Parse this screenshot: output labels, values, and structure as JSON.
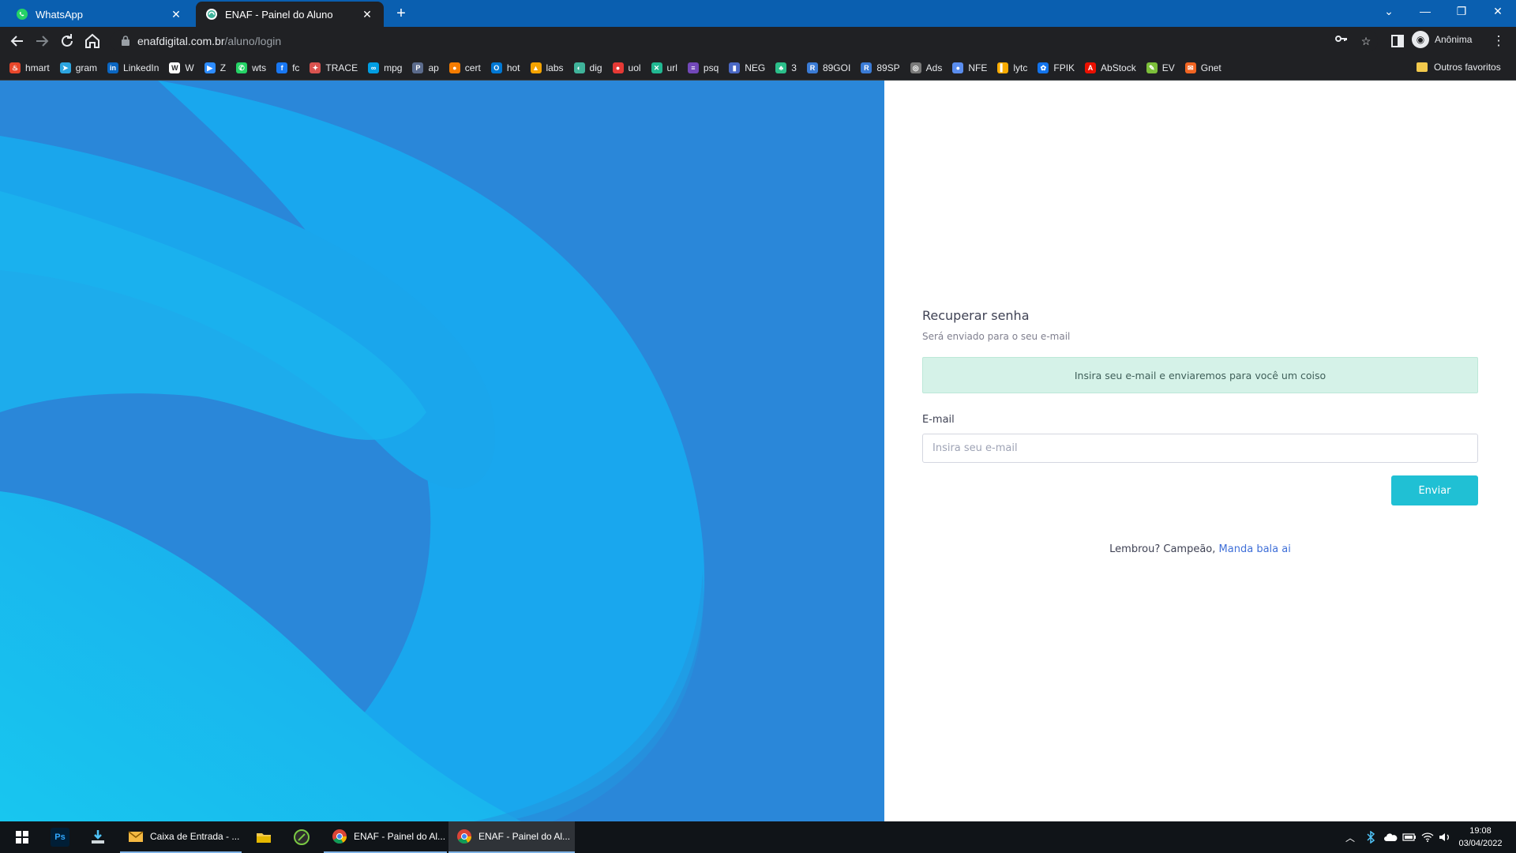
{
  "browser": {
    "tabs": [
      {
        "title": "WhatsApp",
        "icon": "whatsapp-icon",
        "active": false
      },
      {
        "title": "ENAF - Painel do Aluno",
        "icon": "enaf-icon",
        "active": true
      }
    ],
    "url_host": "enafdigital.com.br",
    "url_path": "/aluno/login",
    "profile_label": "Anônima",
    "bookmarks": [
      {
        "label": "hmart",
        "icon": "flame-icon",
        "color": "#e8472b"
      },
      {
        "label": "gram",
        "icon": "telegram-icon",
        "color": "#2ca5e0"
      },
      {
        "label": "LinkedIn",
        "icon": "linkedin-icon",
        "color": "#0a66c2"
      },
      {
        "label": "W",
        "icon": "wix-icon",
        "color": "#ffffff"
      },
      {
        "label": "Z",
        "icon": "zoom-icon",
        "color": "#2d8cff"
      },
      {
        "label": "wts",
        "icon": "whatsapp-icon",
        "color": "#25d366"
      },
      {
        "label": "fc",
        "icon": "facebook-icon",
        "color": "#1877f2"
      },
      {
        "label": "TRACE",
        "icon": "trace-icon",
        "color": "#d9534f"
      },
      {
        "label": "mpg",
        "icon": "mercadopago-icon",
        "color": "#009ee3"
      },
      {
        "label": "ap",
        "icon": "paypal-icon",
        "color": "#5b6b8c"
      },
      {
        "label": "cert",
        "icon": "cert-icon",
        "color": "#f57c00"
      },
      {
        "label": "hot",
        "icon": "outlook-icon",
        "color": "#0078d4"
      },
      {
        "label": "labs",
        "icon": "labs-icon",
        "color": "#f4a300"
      },
      {
        "label": "dig",
        "icon": "enaf-icon",
        "color": "#3fb39a"
      },
      {
        "label": "uol",
        "icon": "uol-icon",
        "color": "#e53935"
      },
      {
        "label": "url",
        "icon": "url-icon",
        "color": "#21b892"
      },
      {
        "label": "psq",
        "icon": "forms-icon",
        "color": "#7248b9"
      },
      {
        "label": "NEG",
        "icon": "neg-icon",
        "color": "#4a68c4"
      },
      {
        "label": "3",
        "icon": "tree-icon",
        "color": "#2bbf8a"
      },
      {
        "label": "89GOI",
        "icon": "r-icon",
        "color": "#3a7bd5"
      },
      {
        "label": "89SP",
        "icon": "r-icon",
        "color": "#3a7bd5"
      },
      {
        "label": "Ads",
        "icon": "ads-icon",
        "color": "#7a7a7a"
      },
      {
        "label": "NFE",
        "icon": "nfe-icon",
        "color": "#5a8dee"
      },
      {
        "label": "lytc",
        "icon": "analytics-icon",
        "color": "#f9ab00"
      },
      {
        "label": "FPIK",
        "icon": "freepik-icon",
        "color": "#1273eb"
      },
      {
        "label": "AbStock",
        "icon": "adobe-icon",
        "color": "#eb1000"
      },
      {
        "label": "EV",
        "icon": "evernote-icon",
        "color": "#7cbf3a"
      },
      {
        "label": "Gnet",
        "icon": "gnet-icon",
        "color": "#f26522"
      }
    ],
    "other_bookmarks": "Outros favoritos"
  },
  "page": {
    "title": "Recuperar senha",
    "subtitle": "Será enviado para o seu e-mail",
    "alert": "Insira seu e-mail e enviaremos para você um coiso",
    "email_label": "E-mail",
    "email_placeholder": "Insira seu e-mail",
    "submit_label": "Enviar",
    "footer_text": "Lembrou? Campeão,",
    "footer_link": "Manda bala ai",
    "accent_color": "#20c0d4",
    "link_color": "#3f6fd8"
  },
  "taskbar": {
    "apps": [
      {
        "label": "",
        "icon": "windows-start-icon"
      },
      {
        "label": "",
        "icon": "photoshop-icon"
      },
      {
        "label": "",
        "icon": "app-installer-icon"
      },
      {
        "label": "Caixa de Entrada - ...",
        "icon": "mail-icon"
      },
      {
        "label": "",
        "icon": "file-explorer-icon"
      },
      {
        "label": "",
        "icon": "sketch-icon"
      },
      {
        "label": "ENAF - Painel do Al...",
        "icon": "chrome-icon"
      },
      {
        "label": "ENAF - Painel do Al...",
        "icon": "chrome-icon"
      }
    ],
    "time": "19:08",
    "date": "03/04/2022"
  }
}
